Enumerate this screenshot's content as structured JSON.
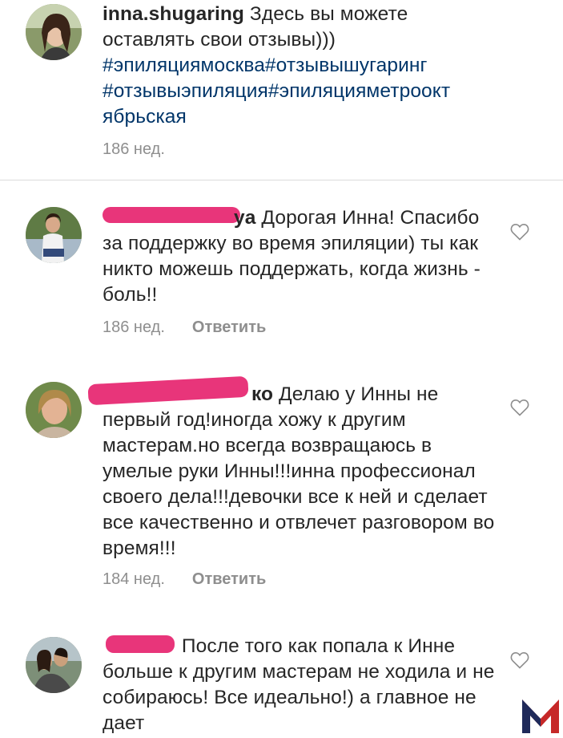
{
  "caption": {
    "username": "inna.shugaring",
    "text": "Здесь вы можете оставлять свои отзывы)))",
    "hashtags": "#эпиляциямосква#отзывышугаринг #отзывыэпиляция#эпиляцияметроокт ябрьская",
    "time": "186 нед."
  },
  "comments": [
    {
      "username_visible": "ya",
      "text": "Дорогая Инна! Спасибо за поддержку во время эпиляции) ты как никто можешь поддержать, когда жизнь - боль!!",
      "time": "186 нед.",
      "reply_label": "Ответить"
    },
    {
      "username_visible": "ко",
      "text": "Делаю у Инны не первый год!иногда хожу к другим мастерам.но всегда возвращаюсь в умелые руки Инны!!!инна профессионал своего дела!!!девочки все к ней и сделает все качественно и отвлечет разговором во время!!!",
      "time": "184 нед.",
      "reply_label": "Ответить"
    },
    {
      "username_visible": "",
      "text": "После того как попала к Инне больше к другим мастерам не ходила и не собираюсь! Все идеально!) а главное не дает"
    }
  ],
  "icons": {
    "like": "heart-outline-icon",
    "watermark": "m-logo"
  },
  "colors": {
    "text": "#262626",
    "meta": "#8e8e8e",
    "hashtag": "#003569",
    "redaction": "#e8357a"
  }
}
